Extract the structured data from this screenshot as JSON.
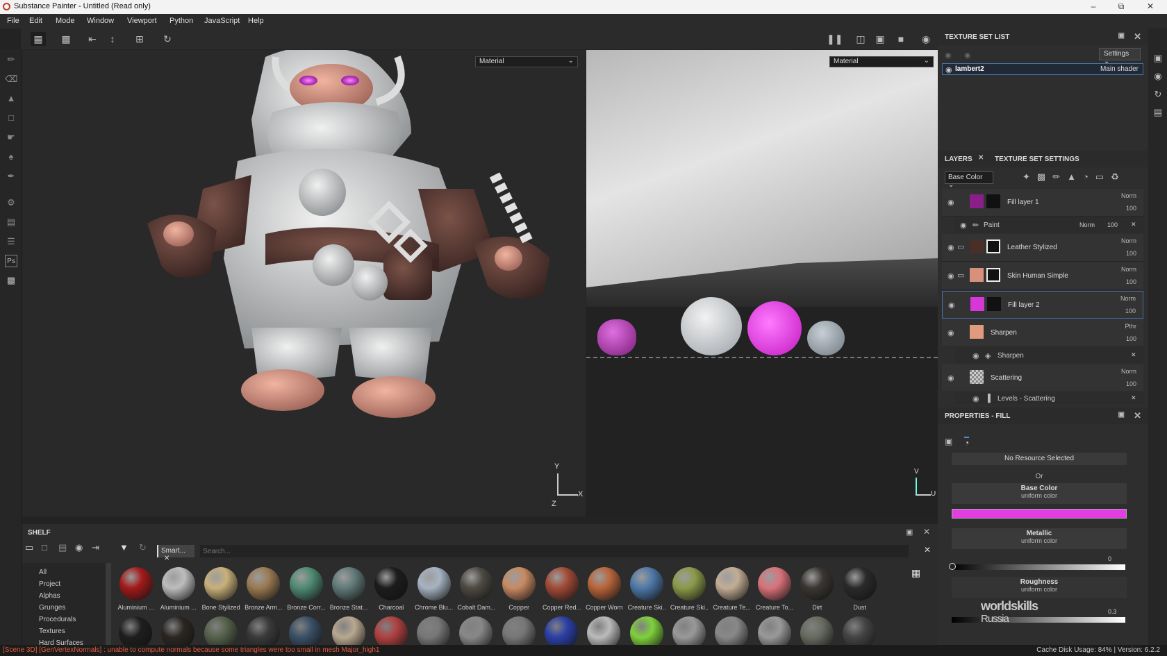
{
  "window": {
    "title": "Substance Painter - Untitled (Read only)"
  },
  "menu": [
    "File",
    "Edit",
    "Mode",
    "Window",
    "Viewport",
    "Python",
    "JavaScript",
    "Help"
  ],
  "viewport3d": {
    "mode": "Material",
    "axis_y": "Y",
    "axis_x": "X",
    "axis_z": "Z"
  },
  "viewport2d": {
    "mode": "Material",
    "axis_v": "V",
    "axis_u": "U"
  },
  "texture_set_list": {
    "title": "TEXTURE SET LIST",
    "settings_label": "Settings",
    "item": {
      "name": "lambert2",
      "shader": "Main shader"
    }
  },
  "layers_panel": {
    "tab_layers": "LAYERS",
    "tab_texture_set_settings": "TEXTURE SET SETTINGS",
    "channel": "Base Color",
    "layers": [
      {
        "name": "Fill layer 1",
        "blend": "Norm",
        "opacity": "100",
        "color": "#8a1f8a"
      },
      {
        "name": "Leather Stylized",
        "blend": "Norm",
        "opacity": "100",
        "color": "#4a2f28"
      },
      {
        "name": "Skin Human Simple",
        "blend": "Norm",
        "opacity": "100",
        "color": "#d9907a"
      },
      {
        "name": "Fill layer 2",
        "blend": "Norm",
        "opacity": "100",
        "color": "#d837d8"
      },
      {
        "name": "Sharpen",
        "blend": "Pthr",
        "opacity": "100",
        "color": "#e09a7c"
      },
      {
        "name": "Scattering",
        "blend": "Norm",
        "opacity": "100",
        "color": "#bbbbbb"
      }
    ],
    "sublayers": {
      "paint": {
        "name": "Paint",
        "blend": "Norm",
        "opacity": "100"
      },
      "sharpen": {
        "name": "Sharpen"
      },
      "levels": {
        "name": "Levels - Scattering"
      }
    }
  },
  "properties": {
    "title": "PROPERTIES - FILL",
    "no_resource": "No Resource Selected",
    "or": "Or",
    "base_color": {
      "label": "Base Color",
      "sub": "uniform color",
      "value": "#e23ee2"
    },
    "metallic": {
      "label": "Metallic",
      "sub": "uniform color",
      "value": "0"
    },
    "roughness": {
      "label": "Roughness",
      "sub": "uniform color",
      "value": "0.3"
    }
  },
  "shelf": {
    "title": "SHELF",
    "filter_tag": "Smart...",
    "search_placeholder": "Search...",
    "categories": [
      "All",
      "Project",
      "Alphas",
      "Grunges",
      "Procedurals",
      "Textures",
      "Hard Surfaces"
    ],
    "materials": [
      {
        "name": "Aluminium ...",
        "color": "#a31a1a"
      },
      {
        "name": "Aluminium ...",
        "color": "#bdbdbd"
      },
      {
        "name": "Bone Stylized",
        "color": "#c9b07a"
      },
      {
        "name": "Bronze Arm...",
        "color": "#9a7a52"
      },
      {
        "name": "Bronze Corr...",
        "color": "#4f8a73"
      },
      {
        "name": "Bronze Stat...",
        "color": "#617a78"
      },
      {
        "name": "Charcoal",
        "color": "#1c1c1c"
      },
      {
        "name": "Chrome Blu...",
        "color": "#a6b3c2"
      },
      {
        "name": "Cobalt Dam...",
        "color": "#4d4a42"
      },
      {
        "name": "Copper",
        "color": "#c88a62"
      },
      {
        "name": "Copper Red...",
        "color": "#a24a36"
      },
      {
        "name": "Copper Worn",
        "color": "#b8643a"
      },
      {
        "name": "Creature Ski...",
        "color": "#4e78a8"
      },
      {
        "name": "Creature Ski...",
        "color": "#8a9a48"
      },
      {
        "name": "Creature Te...",
        "color": "#c2ad95"
      },
      {
        "name": "Creature To...",
        "color": "#d9727a"
      },
      {
        "name": "Dirt",
        "color": "#3a3632"
      },
      {
        "name": "Dust",
        "color": "#2a2a2a"
      }
    ],
    "row2_colors": [
      "#1e1e1e",
      "#2b2622",
      "#55614a",
      "#3a3a3a",
      "#3a4f66",
      "#b8a890",
      "#b04040",
      "#777",
      "#888",
      "#777",
      "#2b3fa8",
      "#bbb",
      "#7fd13c",
      "#999",
      "#888",
      "#999",
      "#676b5f",
      "#444"
    ]
  },
  "status": {
    "error": "[Scene 3D] [GenVertexNormals] : unable to compute normals because some triangles were too small in mesh Major_high1",
    "cache": "Cache Disk Usage:   84% | Version: 6.2.2"
  },
  "watermark": {
    "line1": "world",
    "line2": "skills",
    "line3": "Russia"
  }
}
